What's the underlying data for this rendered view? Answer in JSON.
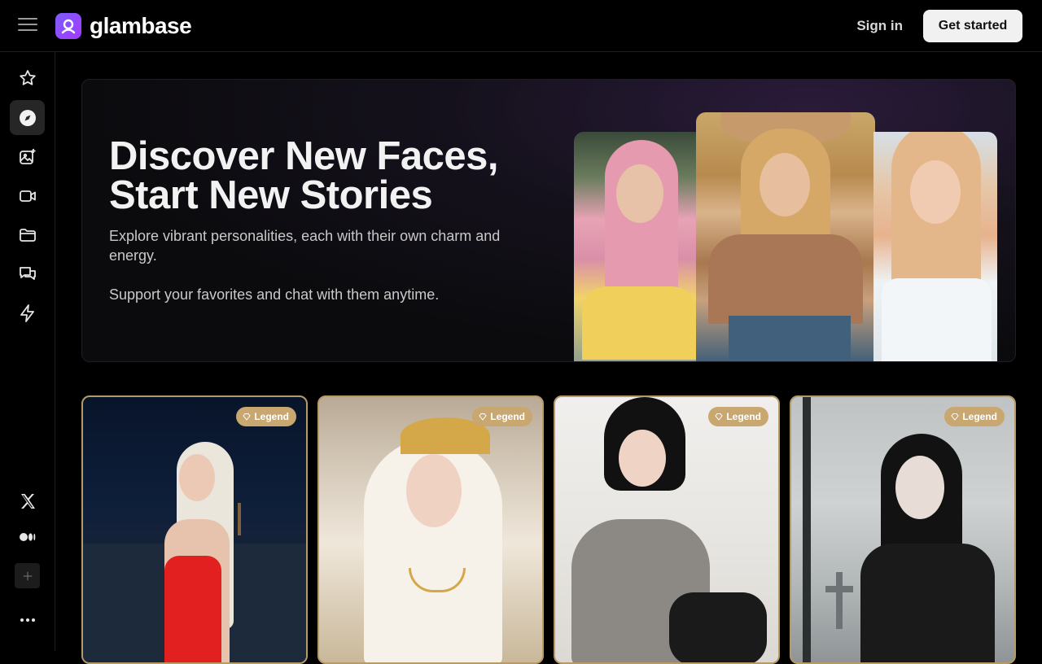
{
  "header": {
    "brand": "glambase",
    "sign_in": "Sign in",
    "get_started": "Get started"
  },
  "sidebar": {
    "items": [
      {
        "icon": "star-icon",
        "active": false
      },
      {
        "icon": "compass-icon",
        "active": true
      },
      {
        "icon": "image-sparkle-icon",
        "active": false
      },
      {
        "icon": "video-icon",
        "active": false
      },
      {
        "icon": "folder-icon",
        "active": false
      },
      {
        "icon": "chat-icon",
        "active": false
      },
      {
        "icon": "lightning-icon",
        "active": false
      }
    ],
    "bottom": [
      {
        "icon": "x-logo-icon"
      },
      {
        "icon": "medium-logo-icon"
      },
      {
        "icon": "plus-icon"
      },
      {
        "icon": "more-icon"
      }
    ]
  },
  "hero": {
    "title": "Discover New Faces, Start New Stories",
    "subtitle": "Explore vibrant personalities, each with their own charm and energy.",
    "subtitle2": "Support your favorites and chat with them anytime."
  },
  "cards": [
    {
      "badge": "Legend"
    },
    {
      "badge": "Legend"
    },
    {
      "badge": "Legend"
    },
    {
      "badge": "Legend"
    }
  ],
  "colors": {
    "accent": "#7c5cff",
    "badge": "#c8a770",
    "card_border": "#b89a67",
    "background": "#000000"
  }
}
